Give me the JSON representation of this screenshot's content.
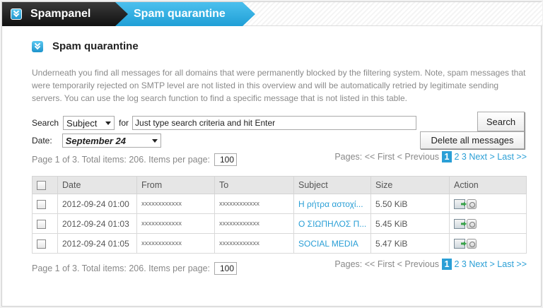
{
  "breadcrumb": {
    "root": "Spampanel",
    "current": "Spam quarantine"
  },
  "section": {
    "title": "Spam quarantine",
    "intro": "Underneath you find all messages for all domains that were permanently blocked by the filtering system. Note, spam messages that were temporarily rejected on SMTP level are not listed in this overview and will be automatically retried by legitimate sending servers. You can use the log search function to find a specific message that is not listed in this table."
  },
  "search": {
    "label": "Search",
    "field_select": "Subject",
    "for_label": "for",
    "query_value": "Just type search criteria and hit Enter",
    "button": "Search"
  },
  "date": {
    "label": "Date:",
    "value": "September 24"
  },
  "delete_all_button": "Delete all messages",
  "pager": {
    "summary": "Page 1 of 3. Total items: 206. Items per page:",
    "items_per_page": "100",
    "pages_label": "Pages:",
    "first": "<< First",
    "previous": "< Previous",
    "current": "1",
    "p2": "2",
    "p3": "3",
    "next": "Next >",
    "last": "Last >>"
  },
  "table": {
    "headers": [
      "Date",
      "From",
      "To",
      "Subject",
      "Size",
      "Action"
    ],
    "rows": [
      {
        "date": "2012-09-24 01:00",
        "from": "xxxxxxxxxxxx",
        "to": "xxxxxxxxxxxx",
        "subject": "Η ρήτρα αστοχί...",
        "size": "5.50 KiB"
      },
      {
        "date": "2012-09-24 01:03",
        "from": "xxxxxxxxxxxx",
        "to": "xxxxxxxxxxxx",
        "subject": "Ο ΣΙΩΠΗΛΟΣ Π...",
        "size": "5.45 KiB"
      },
      {
        "date": "2012-09-24 01:05",
        "from": "xxxxxxxxxxxx",
        "to": "xxxxxxxxxxxx",
        "subject": "SOCIAL MEDIA",
        "size": "5.47 KiB"
      }
    ]
  },
  "colors": {
    "accent": "#2a9fd6",
    "dark_tab": "#1a1a1a"
  }
}
